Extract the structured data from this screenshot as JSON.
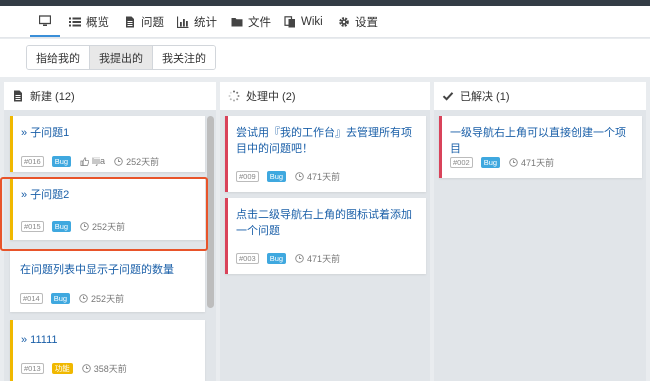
{
  "nav": {
    "items": [
      {
        "label": "",
        "icon": "desktop-icon"
      },
      {
        "label": "概览",
        "icon": "list-icon"
      },
      {
        "label": "问题",
        "icon": "document-icon"
      },
      {
        "label": "统计",
        "icon": "bar-chart-icon"
      },
      {
        "label": "文件",
        "icon": "folder-icon"
      },
      {
        "label": "Wiki",
        "icon": "wiki-icon"
      },
      {
        "label": "设置",
        "icon": "gear-icon"
      }
    ]
  },
  "filters": {
    "items": [
      "指给我的",
      "我提出的",
      "我关注的"
    ],
    "active": "我提出的"
  },
  "columns": [
    {
      "header": "新建 (12)",
      "icon": "document-icon",
      "cards": [
        {
          "title": "» 子问题1",
          "id": "#016",
          "type": "Bug",
          "user": "lijia",
          "age": "252天前"
        },
        {
          "title": "» 子问题2",
          "id": "#015",
          "type": "Bug",
          "age": "252天前"
        },
        {
          "title": "在问题列表中显示子问题的数量",
          "id": "#014",
          "type": "Bug",
          "age": "252天前"
        },
        {
          "title": "» 11111",
          "id": "#013",
          "type": "功能",
          "age": "358天前"
        }
      ]
    },
    {
      "header": "处理中 (2)",
      "icon": "spinner-icon",
      "cards": [
        {
          "title": "尝试用『我的工作台』去管理所有项目中的问题吧！",
          "id": "#009",
          "type": "Bug",
          "age": "471天前"
        },
        {
          "title": "点击二级导航右上角的图标试着添加一个问题",
          "id": "#003",
          "type": "Bug",
          "age": "471天前"
        }
      ]
    },
    {
      "header": "已解决 (1)",
      "icon": "check-icon",
      "cards": [
        {
          "title": "一级导航右上角可以直接创建一个项目",
          "id": "#002",
          "type": "Bug",
          "age": "471天前"
        }
      ]
    }
  ],
  "colors": {
    "accent": "#3a8fd8",
    "yellow": "#f0b800",
    "red": "#d9435a",
    "bug": "#3fa8df",
    "highlight": "#e8542a"
  }
}
